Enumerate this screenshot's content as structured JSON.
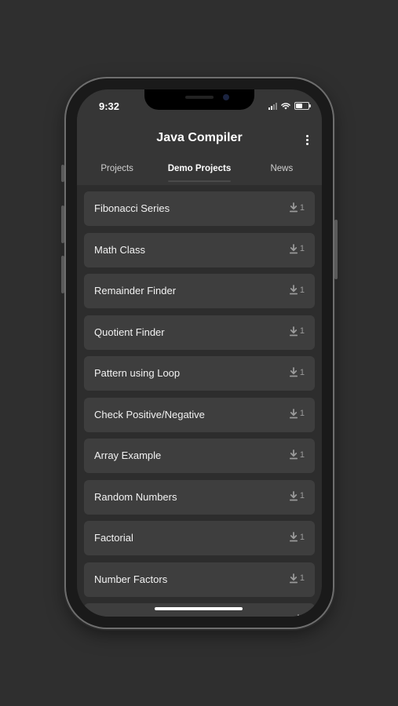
{
  "status_bar": {
    "time": "9:32"
  },
  "app_bar": {
    "title": "Java Compiler",
    "menu_icon": "more-vertical-icon"
  },
  "tabs": [
    {
      "label": "Projects",
      "active": false
    },
    {
      "label": "Demo Projects",
      "active": true
    },
    {
      "label": "News",
      "active": false
    }
  ],
  "items": [
    {
      "label": "Fibonacci Series",
      "downloads": "1"
    },
    {
      "label": "Math Class",
      "downloads": "1"
    },
    {
      "label": "Remainder Finder",
      "downloads": "1"
    },
    {
      "label": "Quotient Finder",
      "downloads": "1"
    },
    {
      "label": "Pattern using Loop",
      "downloads": "1"
    },
    {
      "label": "Check Positive/Negative",
      "downloads": "1"
    },
    {
      "label": "Array Example",
      "downloads": "1"
    },
    {
      "label": "Random Numbers",
      "downloads": "1"
    },
    {
      "label": "Factorial",
      "downloads": "1"
    },
    {
      "label": "Number Factors",
      "downloads": "1"
    },
    {
      "label": "",
      "downloads": ""
    }
  ],
  "colors": {
    "background": "#2f2f2f",
    "screen": "#2d2d2d",
    "bar": "#363636",
    "card": "#3e3e3e",
    "text": "#f2f2f2",
    "muted": "#9a9a9a"
  }
}
